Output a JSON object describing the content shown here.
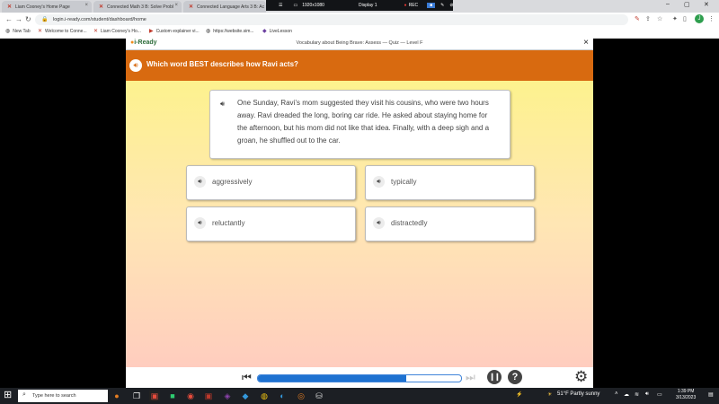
{
  "browser": {
    "tabs": [
      {
        "label": "Liam Cooney's Home Page"
      },
      {
        "label": "Connected Math 3 B: Solve Probl"
      },
      {
        "label": "Connected Language Arts 3 B: Ac"
      }
    ],
    "recording": {
      "resolution": "1920x1080",
      "display": "Display 1",
      "status": "REC"
    },
    "url": "login.i-ready.com/student/dashboard/home",
    "avatar_initial": "J",
    "bookmarks": [
      {
        "label": "New Tab",
        "icon": "globe-icon"
      },
      {
        "label": "Welcome to Conne...",
        "icon": "x-logo-icon"
      },
      {
        "label": "Liam Cooney's Ho...",
        "icon": "x-logo-icon"
      },
      {
        "label": "Custom explainer vi...",
        "icon": "video-icon"
      },
      {
        "label": "https://website.sim...",
        "icon": "globe-icon"
      },
      {
        "label": "LiveLesson",
        "icon": "livelesson-icon"
      }
    ]
  },
  "app": {
    "logo_text": "i-Ready",
    "title": "Vocabulary about Being Brave: Assess — Quiz — Level F",
    "question": "Which word BEST describes how Ravi acts?",
    "passage": "One Sunday, Ravi’s mom suggested they visit his cousins, who were two hours away. Ravi dreaded the long, boring car ride. He asked about staying home for the afternoon, but his mom did not like that idea. Finally, with a deep sigh and a groan, he shuffled out to the car.",
    "answers": [
      {
        "label": "aggressively"
      },
      {
        "label": "typically"
      },
      {
        "label": "reluctantly"
      },
      {
        "label": "distractedly"
      }
    ],
    "progress": 0.73,
    "colors": {
      "question_bar": "#d86a10",
      "progress_fill": "#1e72d1"
    }
  },
  "taskbar": {
    "search_placeholder": "Type here to search",
    "weather": "51°F  Partly sunny",
    "time": "1:39 PM",
    "date": "3/13/2023"
  }
}
